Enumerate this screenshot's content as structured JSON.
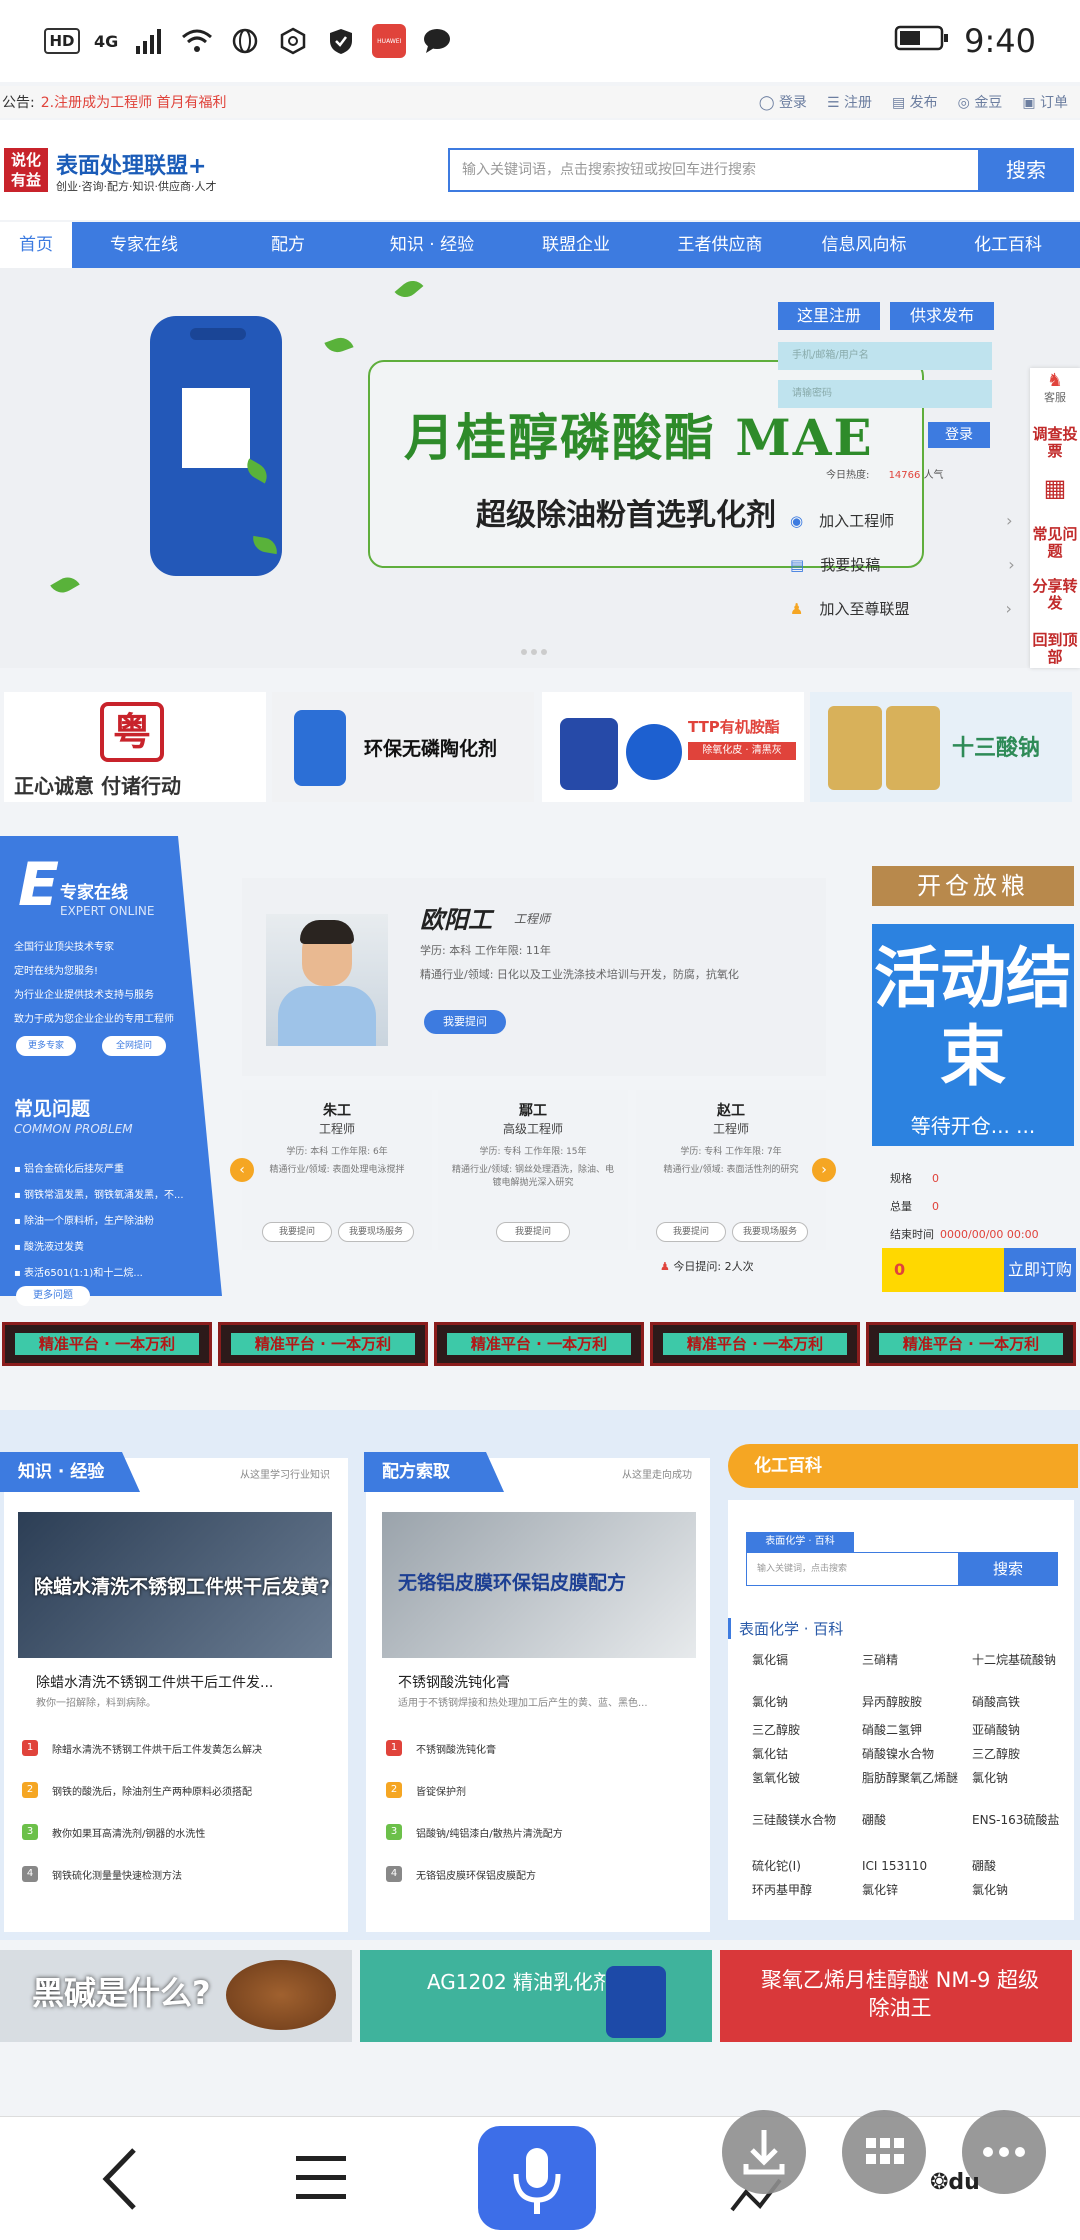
{
  "status_bar": {
    "network": "4G",
    "time": "9:40",
    "badge": "HUAWEI"
  },
  "announce": {
    "label": "公告:",
    "text": "2.注册成为工程师 首月有福利",
    "links": [
      "登录",
      "注册",
      "发布",
      "金豆",
      "订单"
    ]
  },
  "header": {
    "logo_mark": "说化有益",
    "logo_title": "表面处理联盟+",
    "logo_sub": "创业·咨询·配方·知识·供应商·人才",
    "search_placeholder": "输入关键词语，点击搜索按钮或按回车进行搜索",
    "search_button": "搜索"
  },
  "nav": [
    "首页",
    "专家在线",
    "配方",
    "知识 · 经验",
    "联盟企业",
    "王者供应商",
    "信息风向标",
    "化工百科"
  ],
  "banner": {
    "title": "月桂醇磷酸酯 MAE",
    "subtitle": "超级除油粉首选乳化剂",
    "register_btn": "这里注册",
    "publish_btn": "供求发布",
    "phone_placeholder": "手机/邮箱/用户名",
    "password_placeholder": "请输密码",
    "login_btn": "登录",
    "popularity_label": "今日热度:",
    "popularity_value": "14766",
    "popularity_unit": "人气",
    "side_links": [
      "加入工程师",
      "我要投稿",
      "加入至尊联盟"
    ]
  },
  "float_bar": [
    "客服",
    "调查投票",
    "常见问题",
    "分享转发",
    "回到顶部"
  ],
  "ads": [
    {
      "text": "正心诚意  付诸行动"
    },
    {
      "text": "环保无磷陶化剂"
    },
    {
      "text": "TTP有机胺酯",
      "sub": "除氧化皮 · 清黑灰"
    },
    {
      "text": "十三酸钠"
    }
  ],
  "expert_online": {
    "title": "专家在线",
    "en": "EXPERT ONLINE",
    "lines": [
      "全国行业顶尖技术专家",
      "定时在线为您服务!",
      "为行业企业提供技术支持与服务",
      "致力于成为您企业企业的专用工程师"
    ],
    "btn_more": "更多专家",
    "btn_ask": "全网提问",
    "faq_title": "常见问题",
    "faq_en": "COMMON PROBLEM",
    "faq_items": [
      "铝合金硫化后挂灰严重",
      "钢铁常温发黑，钢铁氧涌发黑，不...",
      "除油一个原料析，生产除油粉",
      "酸洗液过发黄",
      "表活6501(1:1)和十二烷..."
    ],
    "faq_more": "更多问题"
  },
  "expert_card": {
    "name": "欧阳工",
    "title": "工程师",
    "edu": "学历: 本科   工作年限: 11年",
    "field": "精通行业/领域: 日化以及工业洗涤技术培训与开发，防腐，抗氧化",
    "ask": "我要提问"
  },
  "mini_experts": [
    {
      "name": "朱工",
      "title": "工程师",
      "info": "学历: 本科   工作年限: 6年",
      "field": "精通行业/领域: 表面处理电泳搅拌",
      "b1": "我要提问",
      "b2": "我要现场服务"
    },
    {
      "name": "鄢工",
      "title": "高级工程师",
      "info": "学历: 专科   工作年限: 15年",
      "field": "精通行业/领域: 钢丝处理酒洗，除油、电镀电解抛光深入研究",
      "b1": "我要提问",
      "b2": ""
    },
    {
      "name": "赵工",
      "title": "工程师",
      "info": "学历: 专科   工作年限: 7年",
      "field": "精通行业/领域: 表面活性剂的研究",
      "b1": "我要提问",
      "b2": "我要现场服务"
    }
  ],
  "today_ask": "今日提问: 2人次",
  "activity": {
    "banner": "开仓放粮",
    "big": "活动结束",
    "wait": "等待开仓... ...",
    "rows": [
      {
        "label": "规格",
        "val": "0"
      },
      {
        "label": "总量",
        "val": "0"
      },
      {
        "label": "结束时间",
        "val": "0000/00/00 00:00"
      }
    ],
    "count": "0",
    "order_btn": "立即订购"
  },
  "platform_banner": "精准平台 · 一本万利",
  "knowledge": {
    "head": "知识 · 经验",
    "tag": "从这里学习行业知识",
    "thumb_title": "除蜡水清洗不锈钢工件烘干后发黄?",
    "art_title": "除蜡水清洗不锈钢工件烘干后工件发...",
    "art_sub": "教你一招解除，料到病除。",
    "items": [
      "除蜡水清洗不锈钢工件烘干后工件发黄怎么解决",
      "钢铁的酸洗后，除油剂生产两种原料必须搭配",
      "教你如果耳高清洗剂/钢器的水洗性",
      "钢铁硫化测量量快速检测方法"
    ]
  },
  "formula": {
    "head": "配方索取",
    "tag": "从这里走向成功",
    "thumb_title": "无铬铝皮膜环保铝皮膜配方",
    "art_title": "不锈钢酸洗钝化膏",
    "art_sub": "适用于不锈钢焊接和热处理加工后产生的黄、蓝、黑色...",
    "items": [
      "不锈钢酸洗钝化膏",
      "皆锭保护剂",
      "铝酸钠/纯铝漆白/散热片清洗配方",
      "无铬铝皮膜环保铝皮膜配方"
    ]
  },
  "chem": {
    "head": "化工百科",
    "tab": "表面化学 · 百科",
    "placeholder": "输入关键词，点击搜索",
    "btn": "搜索",
    "sub": "表面化学 · 百科",
    "grid": [
      [
        "氯化镉",
        "三硝精",
        "十二烷基硫酸钠"
      ],
      [
        "氯化钠",
        "异丙醇胺胺",
        "硝酸高铁"
      ],
      [
        "三乙醇胺",
        "硝酸二氢钾",
        "亚硝酸钠"
      ],
      [
        "氯化钴",
        "硝酸镍水合物",
        "三乙醇胺"
      ],
      [
        "氢氧化铍",
        "脂肪醇聚氧乙烯醚",
        "氯化钠"
      ],
      [
        "三硅酸镁水合物",
        "硼酸",
        "ENS-163硫酸盐"
      ],
      [
        "硫化铊(I)",
        "ICI 153110",
        "硼酸"
      ],
      [
        "环丙基甲醇",
        "氯化锌",
        "氯化钠"
      ]
    ]
  },
  "bottom_ads": [
    "黑碱是什么?",
    "AG1202 精油乳化剂",
    "聚氧乙烯月桂醇醚 NM-9 超级除油王"
  ],
  "colors": {
    "brand_blue": "#3d7be0",
    "accent_orange": "#f5a623",
    "red": "#e0433b"
  }
}
